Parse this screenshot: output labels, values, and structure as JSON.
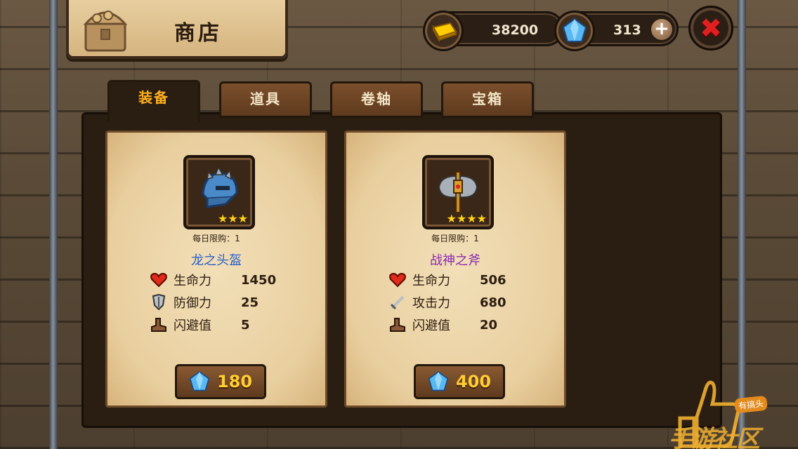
{
  "title": "商店",
  "currency": {
    "gold_value": "38200",
    "gem_value": "313",
    "gold_icon": "gold-bar-icon",
    "gem_icon": "diamond-icon"
  },
  "tabs": [
    {
      "label": "装备",
      "active": true
    },
    {
      "label": "道具",
      "active": false
    },
    {
      "label": "卷轴",
      "active": false
    },
    {
      "label": "宝箱",
      "active": false
    }
  ],
  "items": [
    {
      "name": "龙之头盔",
      "name_color": "#2a5ec8",
      "icon": "helmet-icon",
      "stars": 3,
      "star_text": "★★★",
      "limit": "每日限购：1",
      "stats": [
        {
          "icon": "heart-icon",
          "label": "生命力",
          "value": "1450"
        },
        {
          "icon": "shield-icon",
          "label": "防御力",
          "value": "25"
        },
        {
          "icon": "boot-icon",
          "label": "闪避值",
          "value": "5"
        }
      ],
      "price": "180"
    },
    {
      "name": "战神之斧",
      "name_color": "#8a2ab0",
      "icon": "axe-icon",
      "stars": 4,
      "star_text": "★★★★",
      "limit": "每日限购：1",
      "stats": [
        {
          "icon": "heart-icon",
          "label": "生命力",
          "value": "506"
        },
        {
          "icon": "sword-icon",
          "label": "攻击力",
          "value": "680"
        },
        {
          "icon": "boot-icon",
          "label": "闪避值",
          "value": "20"
        }
      ],
      "price": "400"
    }
  ],
  "watermark": {
    "badge": "有搞头",
    "text": "手游社区"
  }
}
